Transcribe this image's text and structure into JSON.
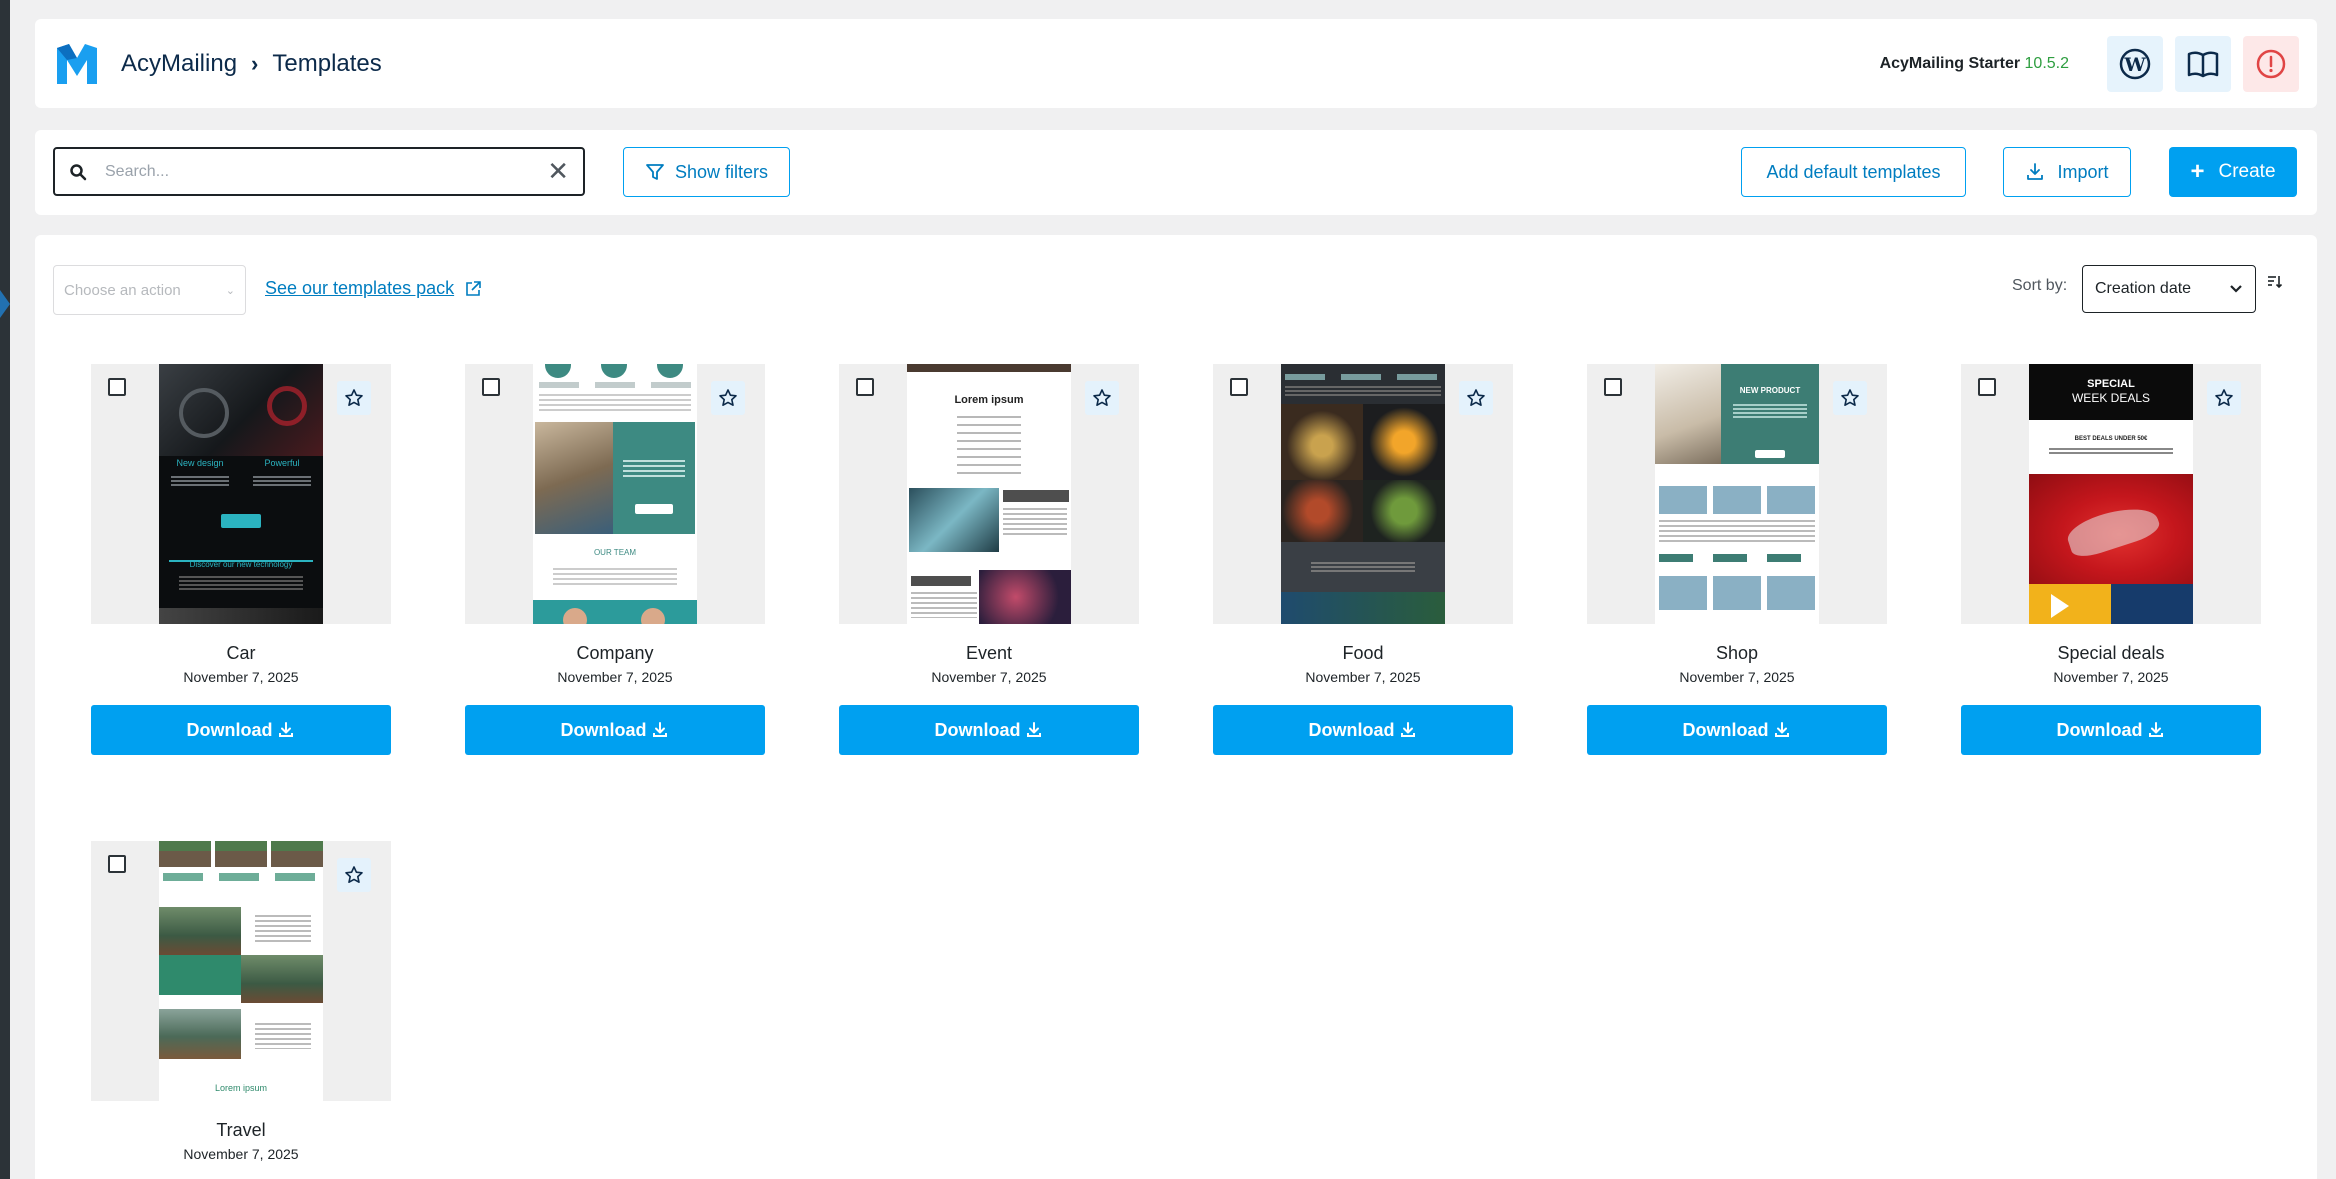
{
  "header": {
    "app_name": "AcyMailing",
    "page": "Templates",
    "version_label": "AcyMailing Starter",
    "version_number": "10.5.2"
  },
  "toolbar": {
    "search_placeholder": "Search...",
    "show_filters": "Show filters",
    "add_default": "Add default templates",
    "import": "Import",
    "create": "Create"
  },
  "listing": {
    "action_placeholder": "Choose an action",
    "pack_link": "See our templates pack",
    "sort_label": "Sort by:",
    "sort_value": "Creation date"
  },
  "download_label": "Download",
  "templates": [
    {
      "name": "Car",
      "date": "November 7, 2025"
    },
    {
      "name": "Company",
      "date": "November 7, 2025"
    },
    {
      "name": "Event",
      "date": "November 7, 2025"
    },
    {
      "name": "Food",
      "date": "November 7, 2025"
    },
    {
      "name": "Shop",
      "date": "November 7, 2025"
    },
    {
      "name": "Special deals",
      "date": "November 7, 2025"
    },
    {
      "name": "Travel",
      "date": "November 7, 2025"
    }
  ],
  "thumb_text": {
    "car_1": "New design",
    "car_2": "Powerful",
    "car_3": "Discover our new technology",
    "company_1": "OUR TEAM",
    "event_1": "Lorem ipsum",
    "shop_1": "NEW PRODUCT",
    "deals_1": "SPECIAL",
    "deals_2": "WEEK DEALS",
    "deals_3": "BEST DEALS UNDER 50€",
    "travel_1": "Lorem ipsum"
  },
  "colors": {
    "accent": "#00a0f0",
    "brand_dark": "#0c2a4a",
    "version_green": "#2e9e40",
    "warn_red": "#e04545"
  }
}
